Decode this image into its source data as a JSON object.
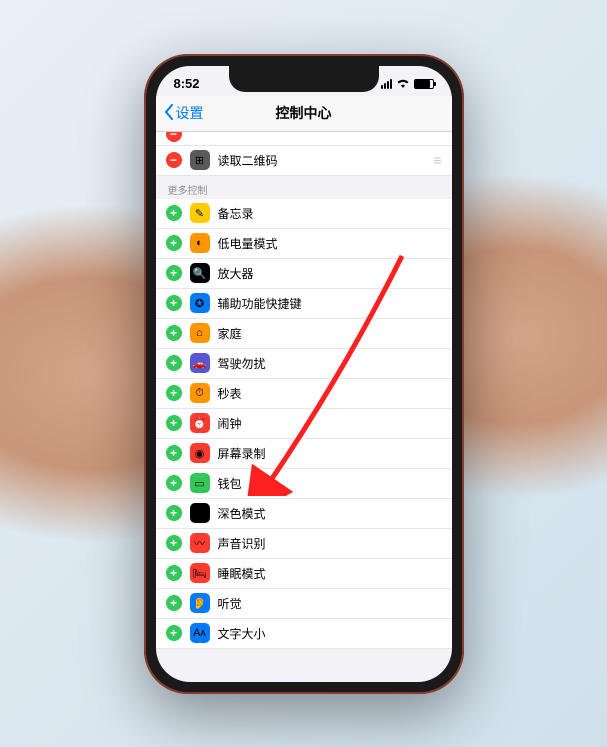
{
  "statusBar": {
    "time": "8:52"
  },
  "nav": {
    "back": "设置",
    "title": "控制中心"
  },
  "includedSection": {
    "items": [
      {
        "icon": "ic-qr",
        "glyph": "⊞",
        "label": "读取二维码",
        "action": "remove"
      }
    ]
  },
  "moreSection": {
    "header": "更多控制",
    "items": [
      {
        "icon": "ic-notes",
        "glyph": "✎",
        "label": "备忘录"
      },
      {
        "icon": "ic-lowpower",
        "glyph": "◐",
        "label": "低电量模式"
      },
      {
        "icon": "ic-magnifier",
        "glyph": "🔍",
        "label": "放大器"
      },
      {
        "icon": "ic-access",
        "glyph": "✪",
        "label": "辅助功能快捷键"
      },
      {
        "icon": "ic-home",
        "glyph": "⌂",
        "label": "家庭"
      },
      {
        "icon": "ic-dnd",
        "glyph": "🚗",
        "label": "驾驶勿扰"
      },
      {
        "icon": "ic-timer",
        "glyph": "⏱",
        "label": "秒表"
      },
      {
        "icon": "ic-alarm",
        "glyph": "⏰",
        "label": "闹钟"
      },
      {
        "icon": "ic-screenrec",
        "glyph": "◉",
        "label": "屏幕录制"
      },
      {
        "icon": "ic-wallet",
        "glyph": "▭",
        "label": "钱包"
      },
      {
        "icon": "ic-darkmode",
        "glyph": "◑",
        "label": "深色模式"
      },
      {
        "icon": "ic-sound",
        "glyph": "〰",
        "label": "声音识别"
      },
      {
        "icon": "ic-sleep",
        "glyph": "🛏",
        "label": "睡眠模式"
      },
      {
        "icon": "ic-hearing",
        "glyph": "👂",
        "label": "听觉"
      },
      {
        "icon": "ic-textsize",
        "glyph": "Aᴀ",
        "label": "文字大小"
      }
    ]
  },
  "annotation": {
    "color": "#ff2020"
  }
}
